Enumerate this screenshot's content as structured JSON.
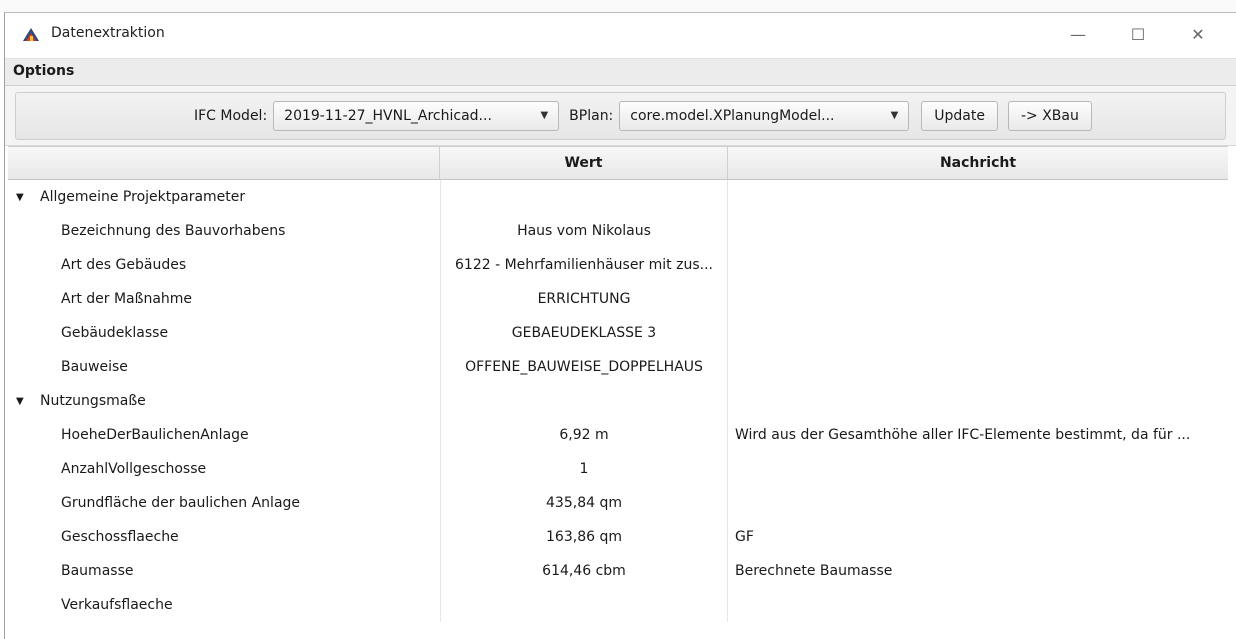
{
  "window": {
    "title": "Datenextraktion",
    "controls": {
      "minimize": "—",
      "maximize": "☐",
      "close": "✕"
    }
  },
  "menu": {
    "options_label": "Options"
  },
  "toolbar": {
    "ifc_label": "IFC Model:",
    "ifc_value": "2019-11-27_HVNL_Archicad...",
    "bplan_label": "BPlan:",
    "bplan_value": "core.model.XPlanungModel...",
    "update_label": "Update",
    "xbau_label": "-> XBau"
  },
  "table": {
    "headers": [
      "",
      "Wert",
      "Nachricht"
    ],
    "groups": [
      {
        "label": "Allgemeine Projektparameter",
        "rows": [
          {
            "name": "Bezeichnung des Bauvorhabens",
            "value": "Haus vom Nikolaus",
            "message": ""
          },
          {
            "name": "Art des Gebäudes",
            "value": "6122 - Mehrfamilienhäuser mit zus...",
            "message": ""
          },
          {
            "name": "Art der Maßnahme",
            "value": "ERRICHTUNG",
            "message": ""
          },
          {
            "name": "Gebäudeklasse",
            "value": "GEBAEUDEKLASSE 3",
            "message": ""
          },
          {
            "name": "Bauweise",
            "value": "OFFENE_BAUWEISE_DOPPELHAUS",
            "message": ""
          }
        ]
      },
      {
        "label": "Nutzungsmaße",
        "rows": [
          {
            "name": "HoeheDerBaulichenAnlage",
            "value": "6,92 m",
            "message": "Wird aus der Gesamthöhe aller IFC-Elemente bestimmt, da für ..."
          },
          {
            "name": "AnzahlVollgeschosse",
            "value": "1",
            "message": ""
          },
          {
            "name": "Grundfläche der baulichen Anlage",
            "value": "435,84 qm",
            "message": ""
          },
          {
            "name": "Geschossflaeche",
            "value": "163,86 qm",
            "message": "GF"
          },
          {
            "name": "Baumasse",
            "value": "614,46 cbm",
            "message": "Berechnete Baumasse"
          },
          {
            "name": "Verkaufsflaeche",
            "value": "",
            "message": ""
          }
        ]
      }
    ]
  },
  "icons": {
    "app": "app-icon",
    "expand": "expanded-triangle-icon",
    "dropdown": "chevron-down-icon"
  }
}
